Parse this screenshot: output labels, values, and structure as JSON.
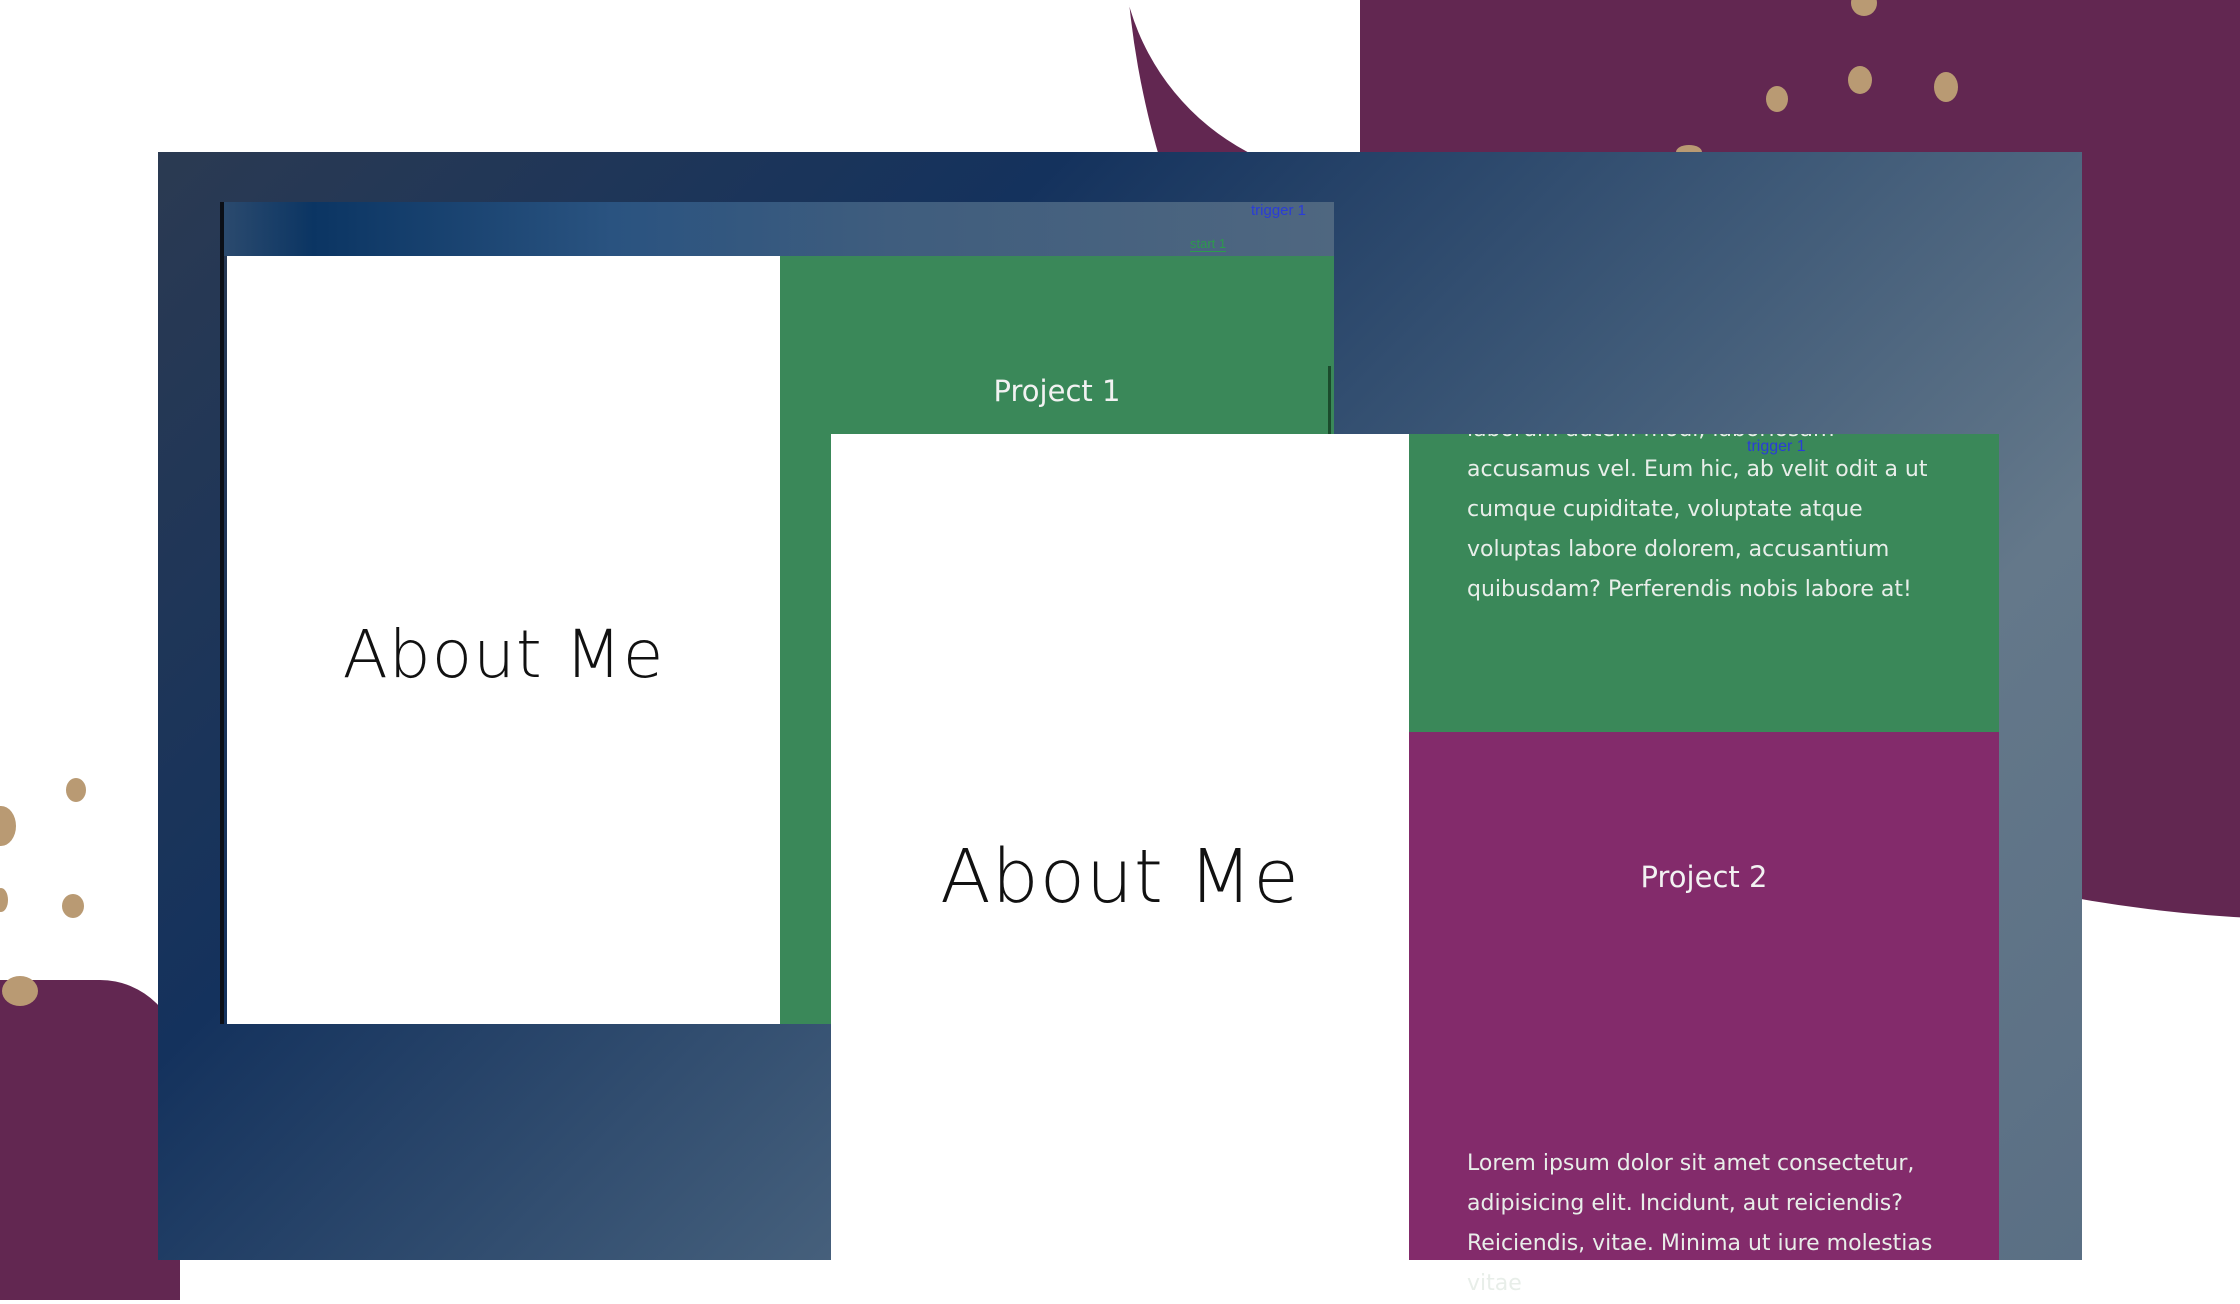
{
  "background": {
    "blob_color": "#622751",
    "dot_color": "#b99a73"
  },
  "window_back": {
    "trigger_label": "trigger 1",
    "start_label": "start 1",
    "about_title": "About Me",
    "project1_title": "Project 1"
  },
  "window_front": {
    "trigger_label": "trigger 1",
    "about_title": "About Me",
    "project1_text": "laborum autem modi, laboriosam accusamus vel. Eum hic, ab velit odit a ut cumque cupiditate, voluptate atque voluptas labore dolorem, accusantium quibusdam? Perferendis nobis labore at!",
    "project2_title": "Project 2",
    "project2_text": "Lorem ipsum dolor sit amet consectetur, adipisicing elit. Incidunt, aut reiciendis? Reiciendis, vitae. Minima ut iure molestias vitae"
  },
  "colors": {
    "green": "#3a8859",
    "purple": "#832b6b",
    "frame_gradient": "#14325d"
  }
}
